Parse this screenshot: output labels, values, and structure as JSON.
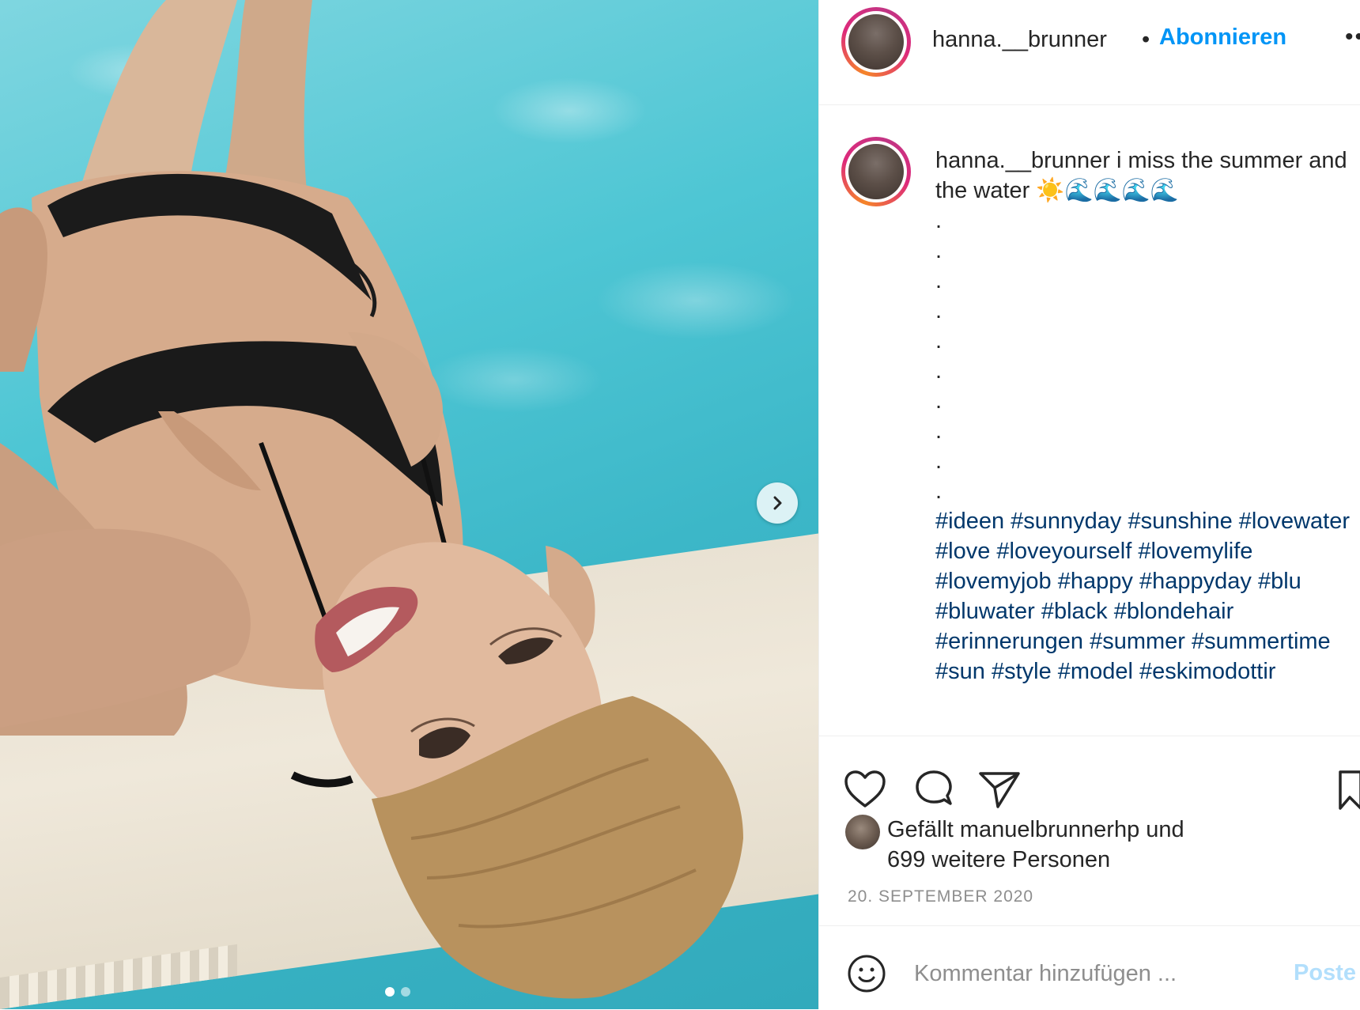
{
  "post": {
    "username": "hanna.__brunner",
    "separator": "•",
    "follow_label": "Abonnieren",
    "more_label": "••",
    "caption": {
      "username": "hanna.__brunner",
      "text": " i miss the summer and the water ☀️🌊🌊🌊🌊",
      "dots": [
        ".",
        ".",
        ".",
        ".",
        ".",
        ".",
        ".",
        ".",
        ".",
        "."
      ],
      "hashtags": [
        "#ideen",
        "#sunnyday",
        "#sunshine",
        "#lovewater",
        "#love",
        "#loveyourself",
        "#lovemylife",
        "#lovemyjob",
        "#happy",
        "#happyday",
        "#blu",
        "#bluwater",
        "#black",
        "#blondehair",
        "#erinnerungen",
        "#summer",
        "#summertime",
        "#sun",
        "#style",
        "#model",
        "#eskimodottir"
      ]
    },
    "likes": {
      "line1": "Gefällt manuelbrunnerhp und",
      "line2": "699 weitere Personen"
    },
    "date": "20. SEPTEMBER 2020",
    "comment": {
      "placeholder": "Kommentar hinzufügen ...",
      "post_label": "Poste"
    },
    "carousel": {
      "slides": 2,
      "active_index": 0
    }
  },
  "icons": {
    "like": "heart-icon",
    "comment": "comment-icon",
    "share": "paper-plane-icon",
    "save": "bookmark-icon",
    "emoji": "smiley-icon",
    "next": "chevron-right-icon"
  },
  "colors": {
    "link": "#0095f6",
    "hashtag": "#00376b",
    "muted": "#8e8e8e",
    "post_disabled": "#b2dffc"
  }
}
